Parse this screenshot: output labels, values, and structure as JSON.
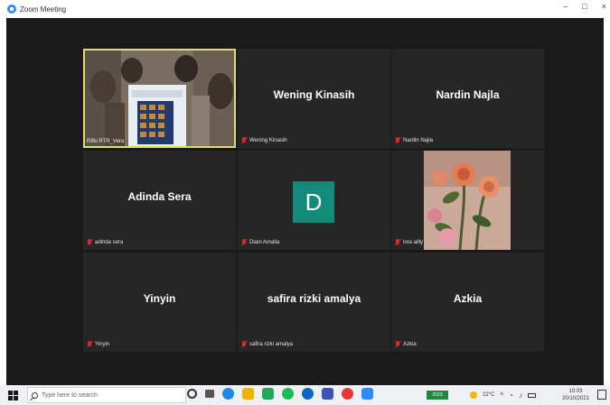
{
  "window": {
    "title": "Zoom Meeting",
    "minimize": "–",
    "maximize": "□",
    "close": "×"
  },
  "participants": [
    {
      "big_name": "",
      "label": "Rifki RTR_Vera",
      "video": true
    },
    {
      "big_name": "Wening Kinasih",
      "label": "Wening Kinasih"
    },
    {
      "big_name": "Nardin Najla",
      "label": "Nardin Najla"
    },
    {
      "big_name": "Adinda Sera",
      "label": "adinda sera"
    },
    {
      "big_name": "",
      "label": "Diani Amalia",
      "avatar_letter": "D"
    },
    {
      "big_name": "",
      "label": "lora ailly",
      "video": true
    },
    {
      "big_name": "Yinyin",
      "label": "Yinyin"
    },
    {
      "big_name": "safira rizki amalya",
      "label": "safira rizki amalya"
    },
    {
      "big_name": "Azkia",
      "label": "Azkia"
    }
  ],
  "taskbar": {
    "search_placeholder": "Type here to search",
    "tray_badge": "2023",
    "weather": "22°C",
    "time": "10:03",
    "date": "20/10/2021"
  },
  "colors": {
    "active_border": "#d8e26a",
    "avatar_bg": "#138a7a",
    "mute": "#e02828",
    "meeting_bg": "#1a1a1a",
    "tile_bg": "#262626"
  }
}
